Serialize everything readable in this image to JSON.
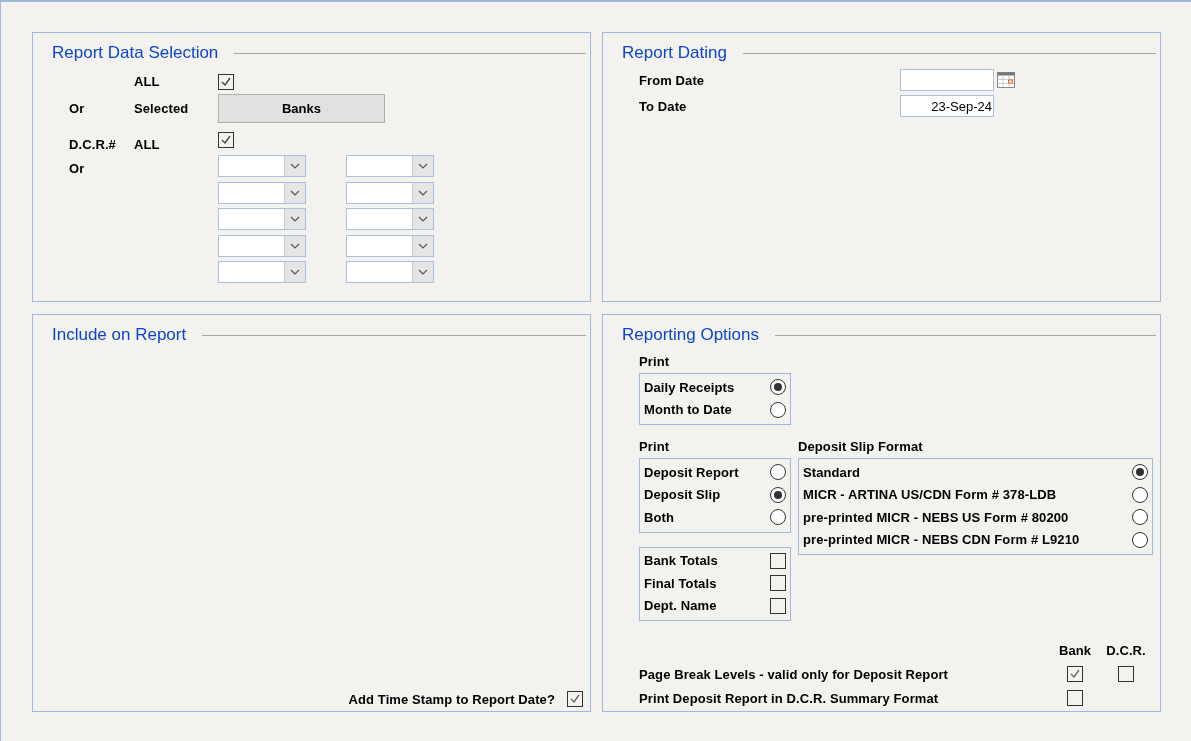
{
  "report_data_selection": {
    "title": "Report Data Selection",
    "banks": {
      "all_label": "ALL",
      "all_checked": true,
      "or_label": "Or",
      "selected_label": "Selected",
      "button": "Banks"
    },
    "dcr": {
      "label": "D.C.R.#",
      "all_label": "ALL",
      "all_checked": true,
      "or_label": "Or"
    }
  },
  "report_dating": {
    "title": "Report Dating",
    "from_date": {
      "label": "From Date"
    },
    "to_date": {
      "label": "To Date",
      "value": "23-Sep-24"
    }
  },
  "include_on_report": {
    "title": "Include on Report",
    "time_stamp": {
      "label": "Add Time Stamp to Report Date?",
      "checked": true
    }
  },
  "reporting_options": {
    "title": "Reporting Options",
    "print_period": {
      "label": "Print",
      "options": [
        {
          "label": "Daily Receipts",
          "selected": true
        },
        {
          "label": "Month to Date",
          "selected": false
        }
      ]
    },
    "print_type": {
      "label": "Print",
      "options": [
        {
          "label": "Deposit Report",
          "selected": false
        },
        {
          "label": "Deposit Slip",
          "selected": true
        },
        {
          "label": "Both",
          "selected": false
        }
      ]
    },
    "totals": [
      {
        "label": "Bank Totals",
        "checked": false
      },
      {
        "label": "Final Totals",
        "checked": false
      },
      {
        "label": "Dept. Name",
        "checked": false
      }
    ],
    "deposit_slip_format": {
      "label": "Deposit Slip Format",
      "options": [
        {
          "label": "Standard",
          "selected": true
        },
        {
          "label": "MICR - ARTINA US/CDN Form # 378-LDB",
          "selected": false
        },
        {
          "label": "pre-printed MICR - NEBS US Form # 80200",
          "selected": false
        },
        {
          "label": "pre-printed MICR - NEBS CDN Form # L9210",
          "selected": false
        }
      ]
    },
    "page_break": {
      "column_headers": [
        "Bank",
        "D.C.R."
      ],
      "rows": [
        {
          "label": "Page Break Levels - valid only for Deposit Report",
          "options": [
            {
              "checked": true
            },
            {
              "checked": false
            }
          ]
        },
        {
          "label": "Print Deposit Report in D.C.R. Summary Format",
          "options": [
            {
              "checked": false
            }
          ]
        }
      ]
    }
  }
}
